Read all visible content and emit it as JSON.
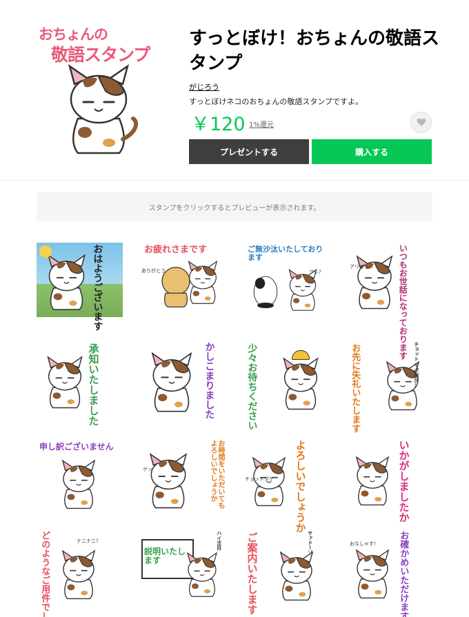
{
  "product": {
    "title": "すっとぼけ！おちょんの敬語スタンプ",
    "author": "がじろう",
    "description": "すっとぼけネコのおちょんの敬語スタンプですよ。",
    "price": "￥120",
    "cashback": "1%還元",
    "main_image_text_line1": "おちょんの",
    "main_image_text_line2": "敬語スタンプ"
  },
  "buttons": {
    "present": "プレゼントする",
    "buy": "購入する"
  },
  "preview_hint": "スタンプをクリックするとプレビューが表示されます。",
  "stickers": [
    {
      "text": "おはようございます",
      "color": "#222222"
    },
    {
      "text": "お疲れさまです",
      "color": "#e8505b",
      "note": "ありがとう"
    },
    {
      "text": "ご無沙汰いたしております",
      "color": "#2a7fc0",
      "note": "グレ？"
    },
    {
      "text": "いつもお世話になっております",
      "color": "#b0306f",
      "note": "アリガト…"
    },
    {
      "text": "承知いたしました",
      "color": "#3a9e4d"
    },
    {
      "text": "かしこまりました",
      "color": "#8a3fc0"
    },
    {
      "text": "少々お待ちください",
      "color": "#3a9e4d"
    },
    {
      "text": "お先に失礼いたします",
      "color": "#e07a1a",
      "note": "チョット ヤボ用が…"
    },
    {
      "text": "申し訳ございません",
      "color": "#8a3fc0"
    },
    {
      "text": "お時間をいただいてもよろしいでしょうか",
      "color": "#e07a1a",
      "note": "ゲッ"
    },
    {
      "text": "よろしいでしょうか",
      "color": "#e07a1a",
      "note": "チョットダケ"
    },
    {
      "text": "いかがしましたか",
      "color": "#d6307a"
    },
    {
      "text": "どのようなご用件でしょうか",
      "color": "#e8505b",
      "note": "ナニナニ？"
    },
    {
      "text": "説明いたします",
      "color": "#3a9e4d",
      "note": "ハイ注目"
    },
    {
      "text": "ご案内いたします",
      "color": "#e8505b",
      "note": "サァドーゾ"
    },
    {
      "text": "お確かめいただけますか",
      "color": "#8a3fc0",
      "note": "おなしゃす！"
    }
  ],
  "colors": {
    "accent_green": "#06c755",
    "present_button": "#3e3e3e",
    "brand_pink": "#ea5a78"
  },
  "icons": {
    "favorite": "heart-icon"
  }
}
